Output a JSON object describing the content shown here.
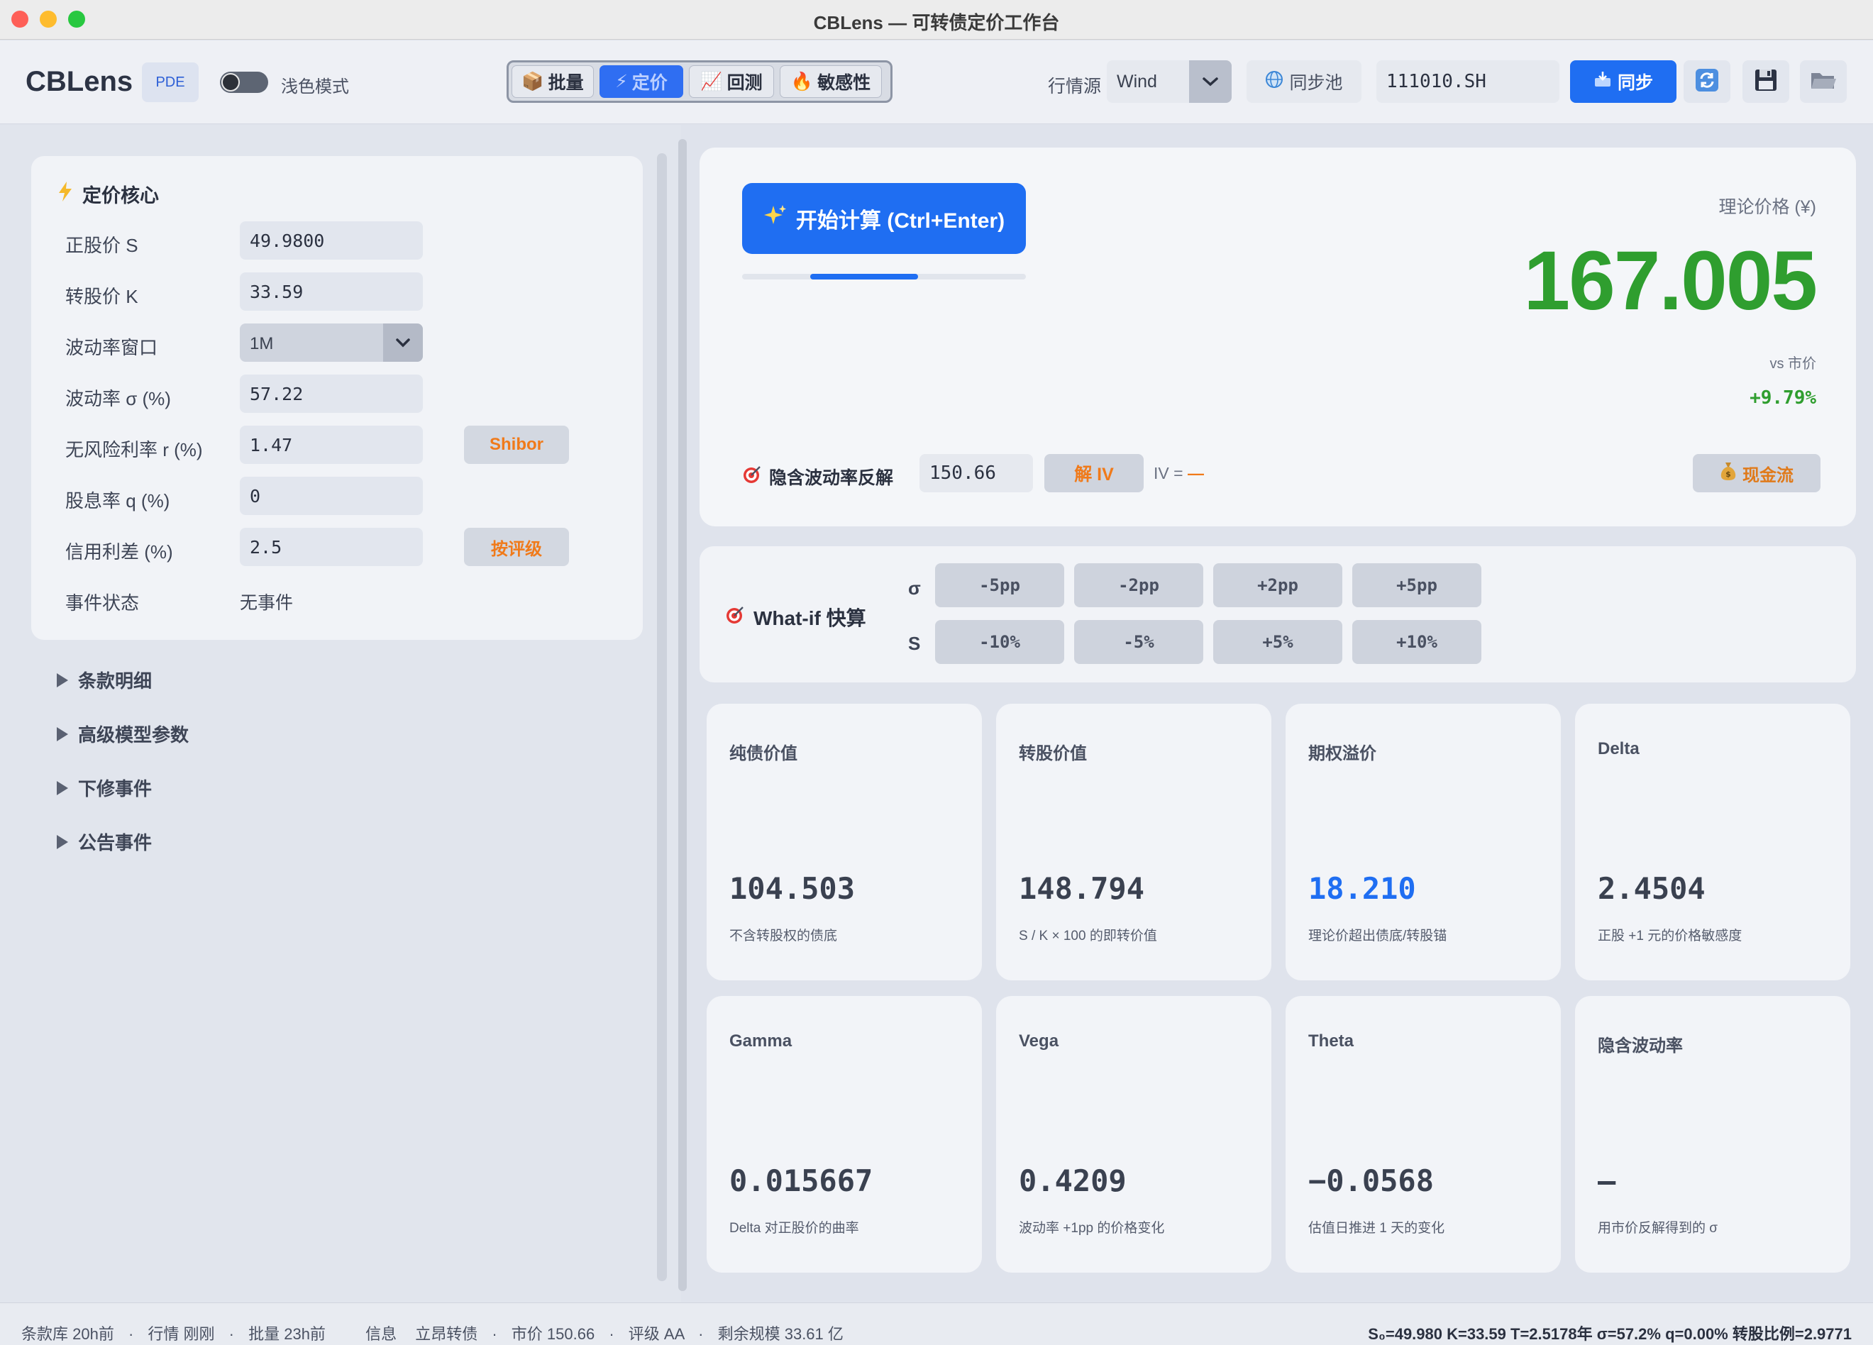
{
  "window": {
    "title": "CBLens — 可转债定价工作台"
  },
  "toolbar": {
    "brand": "CBLens",
    "engine": "PDE",
    "theme_label": "浅色模式",
    "modes": [
      {
        "label": "批量",
        "icon": "📦"
      },
      {
        "label": "定价",
        "icon": "⚡"
      },
      {
        "label": "回测",
        "icon": "📈"
      },
      {
        "label": "敏感性",
        "icon": "🔥"
      }
    ],
    "active_mode": "定价",
    "source_label": "行情源",
    "source_value": "Wind",
    "pool_label": "同步池",
    "code_value": "111010.SH",
    "sync_label": "同步"
  },
  "core": {
    "title": "定价核心",
    "fields": {
      "stock_price": {
        "label": "正股价 S",
        "value": "49.9800"
      },
      "conv_price": {
        "label": "转股价 K",
        "value": "33.59"
      },
      "vol_window": {
        "label": "波动率窗口",
        "value": "1M"
      },
      "vol": {
        "label": "波动率 σ (%)",
        "value": "57.22"
      },
      "rf": {
        "label": "无风险利率 r (%)",
        "value": "1.47",
        "button": "Shibor"
      },
      "div": {
        "label": "股息率 q (%)",
        "value": "0"
      },
      "spread": {
        "label": "信用利差 (%)",
        "value": "2.5",
        "button": "按评级"
      },
      "event": {
        "label": "事件状态",
        "value": "无事件"
      }
    }
  },
  "sections": [
    "条款明细",
    "高级模型参数",
    "下修事件",
    "公告事件"
  ],
  "pricing": {
    "calc_label": "开始计算 (Ctrl+Enter)",
    "progress": 0.43,
    "theo_label": "理论价格 (¥)",
    "theo_value": "167.005",
    "vs_label": "vs 市价",
    "vs_value": "+9.79%",
    "iv_label": "隐含波动率反解",
    "iv_input": "150.66",
    "iv_button": "解 IV",
    "iv_result_prefix": "IV = ",
    "iv_result": "—",
    "cashflow_label": "现金流"
  },
  "whatif": {
    "title": "What-if 快算",
    "sigma_key": "σ",
    "s_key": "S",
    "sigma_buttons": [
      "-5pp",
      "-2pp",
      "+2pp",
      "+5pp"
    ],
    "s_buttons": [
      "-10%",
      "-5%",
      "+5%",
      "+10%"
    ]
  },
  "metrics": [
    {
      "label": "纯债价值",
      "value": "104.503",
      "desc": "不含转股权的债底"
    },
    {
      "label": "转股价值",
      "value": "148.794",
      "desc": "S / K × 100 的即转价值"
    },
    {
      "label": "期权溢价",
      "value": "18.210",
      "desc": "理论价超出债底/转股锚",
      "color": "#1f6ef2"
    },
    {
      "label": "Delta",
      "value": "2.4504",
      "desc": "正股 +1 元的价格敏感度"
    },
    {
      "label": "Gamma",
      "value": "0.015667",
      "desc": "Delta 对正股价的曲率"
    },
    {
      "label": "Vega",
      "value": "0.4209",
      "desc": "波动率 +1pp 的价格变化"
    },
    {
      "label": "Theta",
      "value": "−0.0568",
      "desc": "估值日推进 1 天的变化"
    },
    {
      "label": "隐含波动率",
      "value": "—",
      "desc": "用市价反解得到的 σ"
    }
  ],
  "status": {
    "left": [
      "条款库 20h前",
      "·",
      "行情 刚刚",
      "·",
      "批量 23h前",
      "信息",
      "立昂转债",
      "·",
      "市价 150.66",
      "·",
      "评级 AA",
      "·",
      "剩余规模 33.61 亿"
    ],
    "right": "S₀=49.980  K=33.59  T=2.5178年  σ=57.2%  q=0.00%  转股比例=2.9771"
  }
}
